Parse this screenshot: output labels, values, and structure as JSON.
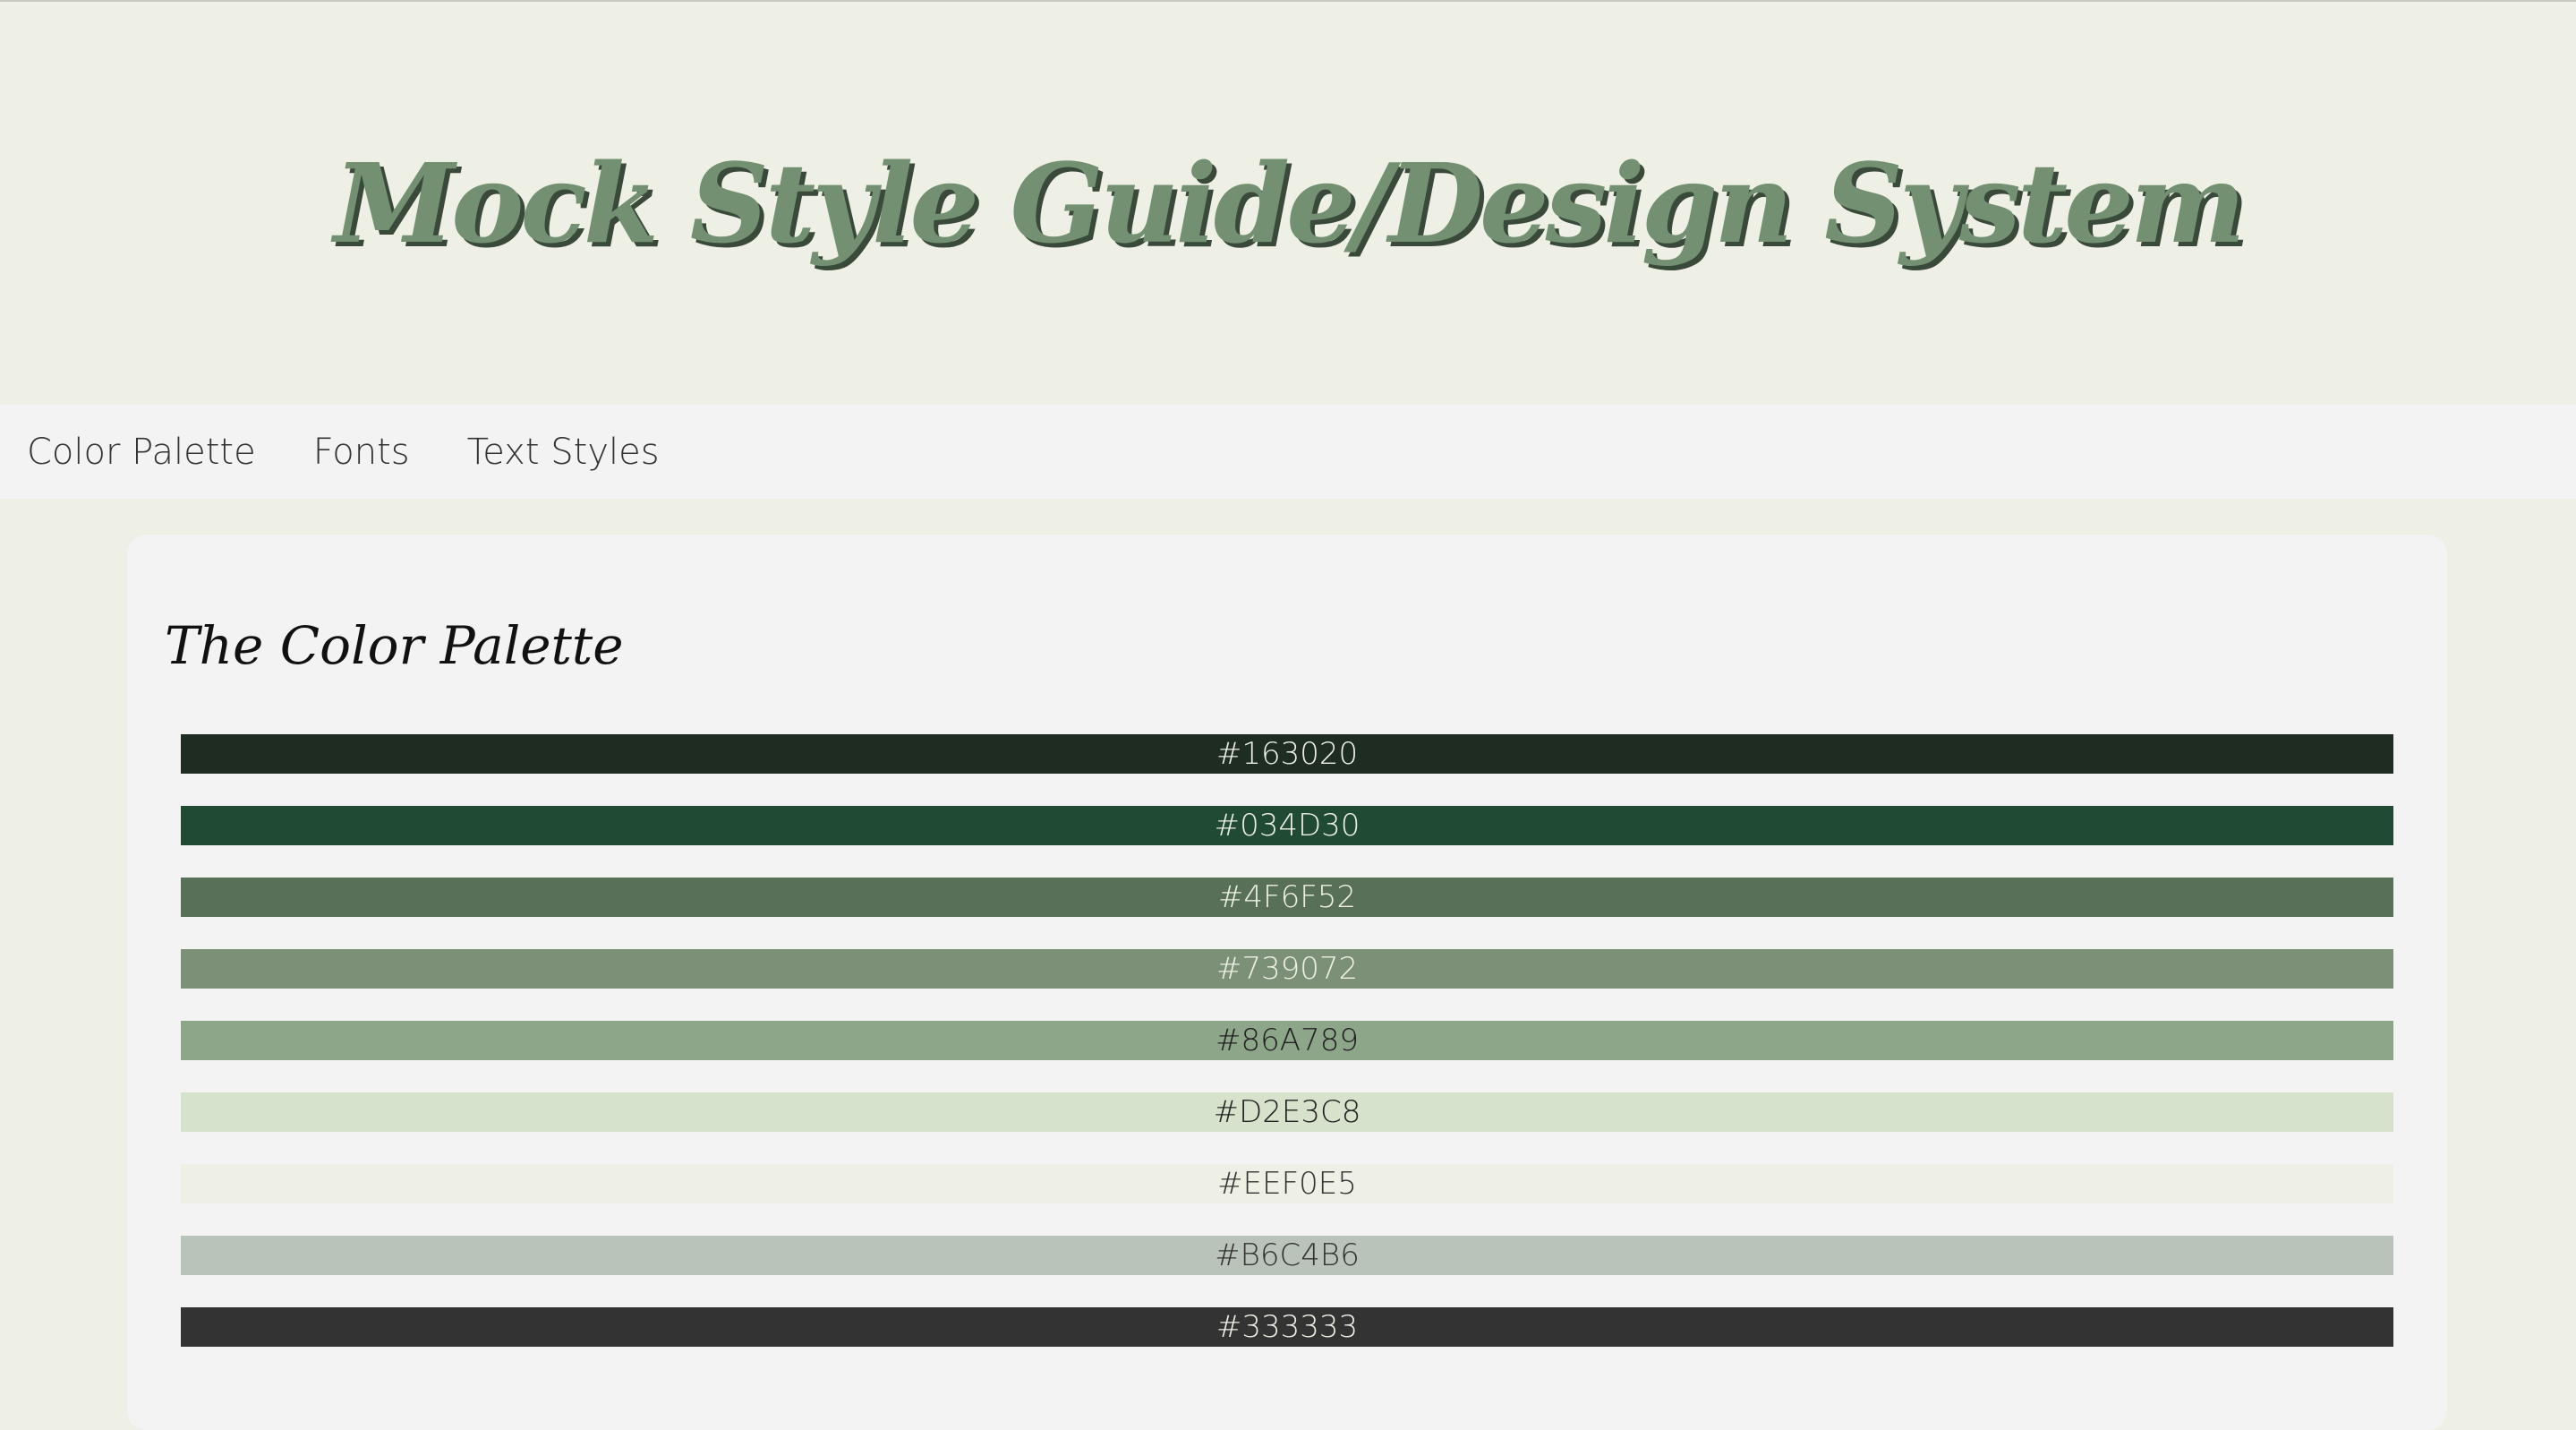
{
  "header": {
    "title": "Mock Style Guide/Design System"
  },
  "nav": {
    "items": [
      "Color Palette",
      "Fonts",
      "Text Styles"
    ]
  },
  "palette": {
    "title": "The Color Palette",
    "swatches": [
      {
        "label": "#163020",
        "color": "#1E2C22",
        "text_color": "#EEF0E5"
      },
      {
        "label": "#034D30",
        "color": "#204A33",
        "text_color": "#EEF0E5"
      },
      {
        "label": "#4F6F52",
        "color": "#577057",
        "text_color": "#EEF0E5"
      },
      {
        "label": "#739072",
        "color": "#7B9077",
        "text_color": "#EEF0E5"
      },
      {
        "label": "#86A789",
        "color": "#8DA589",
        "text_color": "#222222"
      },
      {
        "label": "#D2E3C8",
        "color": "#D6E2CB",
        "text_color": "#222222"
      },
      {
        "label": "#EEF0E5",
        "color": "#EEF0E5",
        "text_color": "#333333"
      },
      {
        "label": "#B6C4B6",
        "color": "#BAC3B9",
        "text_color": "#333333"
      },
      {
        "label": "#333333",
        "color": "#333333",
        "text_color": "#EEF0E5"
      }
    ]
  }
}
